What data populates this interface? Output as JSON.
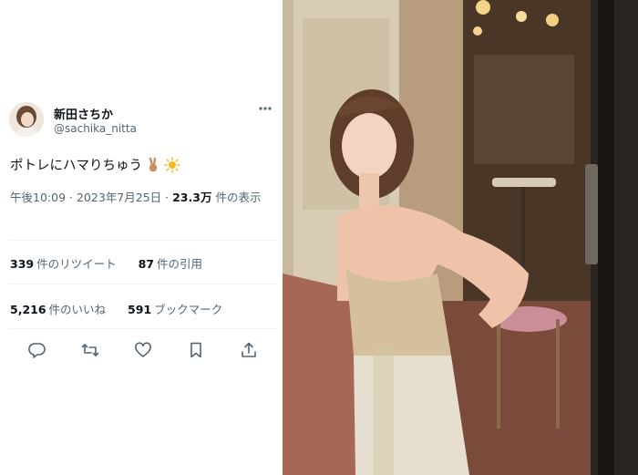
{
  "user": {
    "display_name": "新田さちか",
    "handle": "@sachika_nitta"
  },
  "tweet": {
    "text": "ポトレにハマりちゅう",
    "emojis": [
      "victory-hand-icon",
      "sun-icon"
    ],
    "time": "午後10:09",
    "date": "2023年7月25日",
    "views_count": "23.3万",
    "views_label": "件の表示",
    "separator": "·"
  },
  "stats": {
    "retweets": {
      "count": "339",
      "label": "件のリツイート"
    },
    "quotes": {
      "count": "87",
      "label": "件の引用"
    },
    "likes": {
      "count": "5,216",
      "label": "件のいいね"
    },
    "bookmarks": {
      "count": "591",
      "label": "ブックマーク"
    }
  },
  "actions": [
    "reply-icon",
    "retweet-icon",
    "like-icon",
    "bookmark-icon",
    "share-icon"
  ],
  "colors": {
    "text_primary": "#0f1419",
    "text_secondary": "#536471",
    "divider": "#eff3f4"
  }
}
